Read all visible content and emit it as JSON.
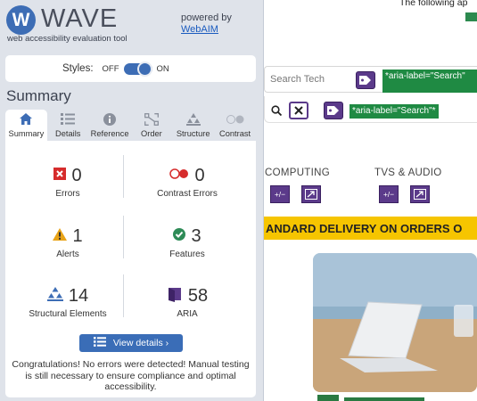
{
  "wave": {
    "logo_letter": "W",
    "logo_text": "WAVE",
    "tagline": "web accessibility evaluation tool",
    "powered_by": "powered by",
    "powered_by_link": "WebAIM",
    "styles": {
      "label": "Styles:",
      "off": "OFF",
      "on": "ON",
      "state": "on"
    },
    "summary_title": "Summary",
    "tabs": [
      {
        "label": "Summary",
        "icon": "home-icon",
        "active": true
      },
      {
        "label": "Details",
        "icon": "list-icon",
        "active": false
      },
      {
        "label": "Reference",
        "icon": "info-icon",
        "active": false
      },
      {
        "label": "Order",
        "icon": "order-icon",
        "active": false
      },
      {
        "label": "Structure",
        "icon": "structure-icon",
        "active": false
      },
      {
        "label": "Contrast",
        "icon": "contrast-icon",
        "active": false
      }
    ],
    "stats": {
      "errors": {
        "value": "0",
        "label": "Errors",
        "icon": "error-icon",
        "color": "#d62c2c"
      },
      "contrast_errors": {
        "value": "0",
        "label": "Contrast Errors",
        "icon": "contrast-error-icon",
        "color": "#d62c2c"
      },
      "alerts": {
        "value": "1",
        "label": "Alerts",
        "icon": "alert-icon",
        "color": "#e8a317"
      },
      "features": {
        "value": "3",
        "label": "Features",
        "icon": "feature-icon",
        "color": "#2e8b57"
      },
      "structural": {
        "value": "14",
        "label": "Structural Elements",
        "icon": "structure-icon",
        "color": "#3d6db5"
      },
      "aria": {
        "value": "58",
        "label": "ARIA",
        "icon": "aria-icon",
        "color": "#5b3a8a"
      }
    },
    "view_details": "View details ›",
    "congrats": "Congratulations! No errors were detected! Manual testing is still necessary to ensure compliance and optimal accessibility."
  },
  "page": {
    "intro_text": "The following ap",
    "search_placeholder": "Search Tech",
    "aria_label_1": "*aria-label=\"Search\"",
    "aria_label_2": "*aria-label=\"Search\"*",
    "categories": [
      "COMPUTING",
      "TVS & AUDIO"
    ],
    "banner": "ANDARD DELIVERY ON ORDERS O",
    "accent_purple": "#5b3a8a",
    "accent_green": "#1f8a43",
    "banner_color": "#f6c500"
  }
}
